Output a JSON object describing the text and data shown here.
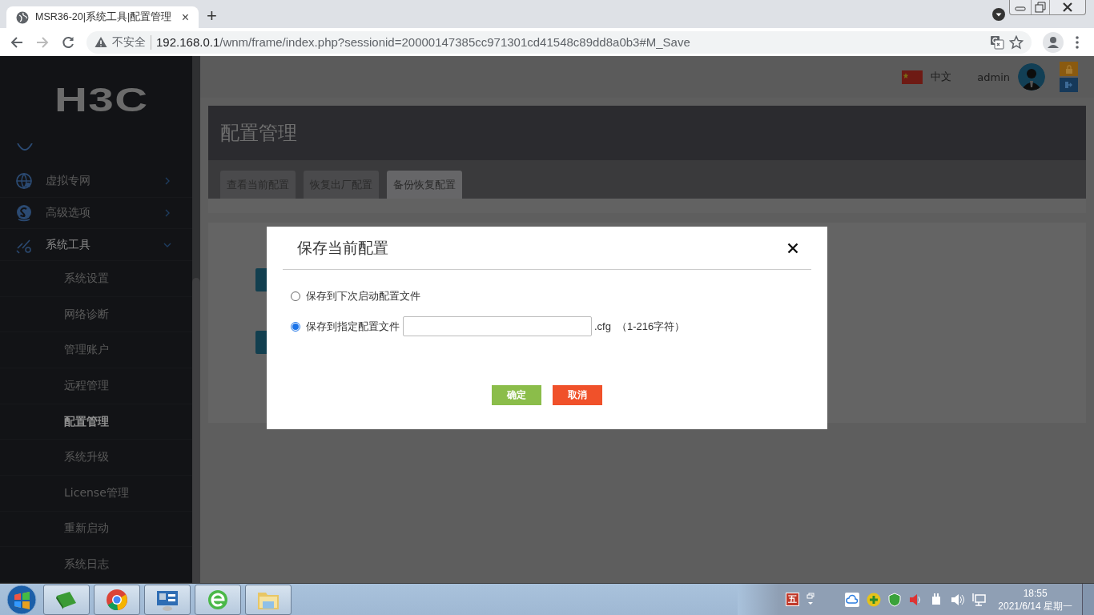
{
  "browser": {
    "tab_title": "MSR36-20|系统工具|配置管理",
    "tab_close": "×",
    "new_tab": "+",
    "security_label": "不安全",
    "url_host": "192.168.0.1",
    "url_path": "/wnm/frame/index.php?sessionid=20000147385cc971301cd41548c89dd8a0b3#M_Save"
  },
  "logo": "H3C",
  "sidebar": {
    "items": [
      {
        "label": "虚拟专网",
        "expanded": false
      },
      {
        "label": "高级选项",
        "expanded": false
      },
      {
        "label": "系统工具",
        "expanded": true,
        "children": [
          {
            "label": "系统设置",
            "selected": false
          },
          {
            "label": "网络诊断",
            "selected": false
          },
          {
            "label": "管理账户",
            "selected": false
          },
          {
            "label": "远程管理",
            "selected": false
          },
          {
            "label": "配置管理",
            "selected": true
          },
          {
            "label": "系统升级",
            "selected": false
          },
          {
            "label": "License管理",
            "selected": false
          },
          {
            "label": "重新启动",
            "selected": false
          },
          {
            "label": "系统日志",
            "selected": false
          }
        ]
      }
    ]
  },
  "header": {
    "language": "中文",
    "user": "admin"
  },
  "page": {
    "title": "配置管理",
    "tabs": [
      {
        "label": "查看当前配置",
        "selected": false
      },
      {
        "label": "恢复出厂配置",
        "selected": false
      },
      {
        "label": "备份恢复配置",
        "selected": true
      }
    ]
  },
  "dialog": {
    "title": "保存当前配置",
    "options": [
      {
        "kind": "plain",
        "label": "保存到下次启动配置文件",
        "selected": false
      },
      {
        "kind": "file",
        "label": "保存到指定配置文件",
        "selected": true,
        "suffix": ".cfg",
        "hint": "（1-216字符）"
      }
    ],
    "buttons": [
      {
        "kind": "confirm",
        "label": "确定"
      },
      {
        "kind": "cancel",
        "label": "取消"
      }
    ]
  },
  "taskbar": {
    "ime_label": "五",
    "clock": "18:55",
    "date": "2021/6/14 星期一"
  }
}
